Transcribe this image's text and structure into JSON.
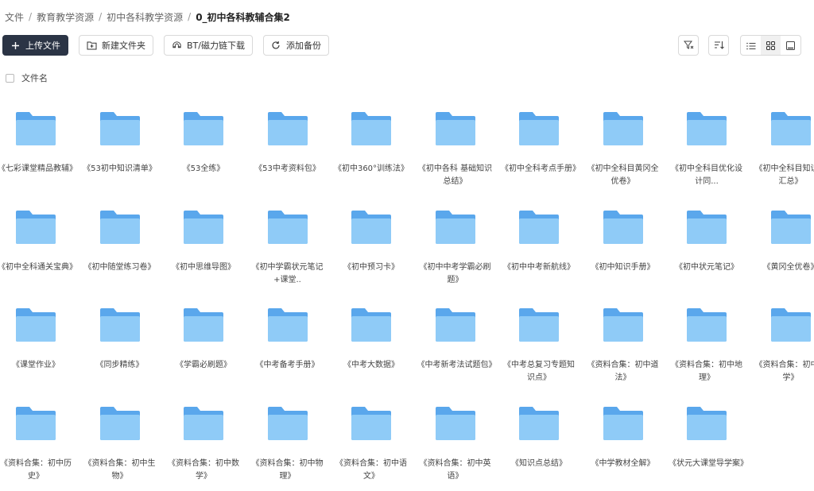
{
  "breadcrumb": [
    "文件",
    "教育教学资源",
    "初中各科教学资源",
    "0_初中各科教辅合集2"
  ],
  "toolbar": {
    "upload": "上传文件",
    "new_folder": "新建文件夹",
    "bt_download": "BT/磁力链下载",
    "add_backup": "添加备份"
  },
  "list_header": {
    "name_column": "文件名"
  },
  "colors": {
    "primary": "#2b3445",
    "folder_back": "#5aa7ec",
    "folder_front": "#8fcbf7"
  },
  "files": [
    "《七彩课堂精品教辅》",
    "《53初中知识清单》",
    "《53全练》",
    "《53中考资料包》",
    "《初中360°训练法》",
    "《初中各科 基础知识总结》",
    "《初中全科考点手册》",
    "《初中全科目黄冈全优卷》",
    "《初中全科目优化设计同...",
    "《初中全科目知识点汇总》",
    "《初中全科通关宝典》",
    "《初中随堂练习卷》",
    "《初中思维导图》",
    "《初中学霸状元笔记+课堂..",
    "《初中预习卡》",
    "《初中中考学霸必刷题》",
    "《初中中考新航线》",
    "《初中知识手册》",
    "《初中状元笔记》",
    "《黄冈全优卷》",
    "《课堂作业》",
    "《同步精练》",
    "《学霸必刷题》",
    "《中考备考手册》",
    "《中考大数据》",
    "《中考新考法试题包》",
    "《中考总复习专题知识点》",
    "《资料合集：初中道法》",
    "《资料合集：初中地理》",
    "《资料合集：初中化学》",
    "《资料合集：初中历史》",
    "《资料合集：初中生物》",
    "《资料合集：初中数学》",
    "《资料合集：初中物理》",
    "《资料合集：初中语文》",
    "《资料合集：初中英语》",
    "《知识点总结》",
    "《中学教材全解》",
    "《状元大课堂导学案》"
  ]
}
